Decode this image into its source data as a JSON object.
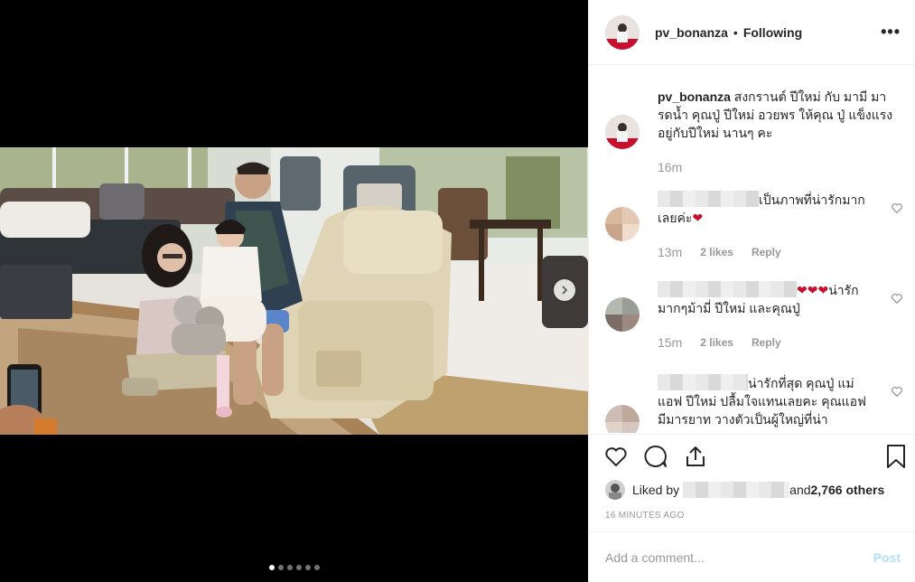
{
  "post": {
    "username": "pv_bonanza",
    "separator": "•",
    "follow_status": "Following",
    "more_label": "•••",
    "caption_user": "pv_bonanza",
    "caption_text": " สงกรานต์ ปีใหม่ กับ มามี มารดน้ำ คุณปู่ ปีใหม่ อวยพร ให้คุณ ปู่ แข็งแรง อยู่กับปีใหม่ นานๆ คะ",
    "caption_time": "16m"
  },
  "comments": [
    {
      "text": "เป็นภาพที่น่ารักมากเลยค่ะ",
      "emoji": "❤",
      "time": "13m",
      "likes": "2 likes",
      "reply": "Reply"
    },
    {
      "text_hearts": "❤❤❤",
      "text": "น่ารักมากๆม้ามี่ ปีใหม่ และคุณปู่",
      "time": "15m",
      "likes": "2 likes",
      "reply": "Reply"
    },
    {
      "text": "น่ารักที่สุด คุณปู่ แม่แอฟ ปีใหม่ ปลื้มใจแทนเลยคะ คุณแอฟมีมารยาท วางตัวเป็นผู้ใหญ่ที่น่า"
    }
  ],
  "liked": {
    "prefix": "Liked by",
    "suffix_and": "and ",
    "others": "2,766 others"
  },
  "timestamp": "16 MINUTES AGO",
  "add_comment": {
    "placeholder": "Add a comment...",
    "post_label": "Post"
  },
  "carousel": {
    "total": 6,
    "active": 1
  },
  "colors": {
    "link_blue_disabled": "#b2dffc",
    "muted": "#999999",
    "heart_red": "#c8102e"
  }
}
